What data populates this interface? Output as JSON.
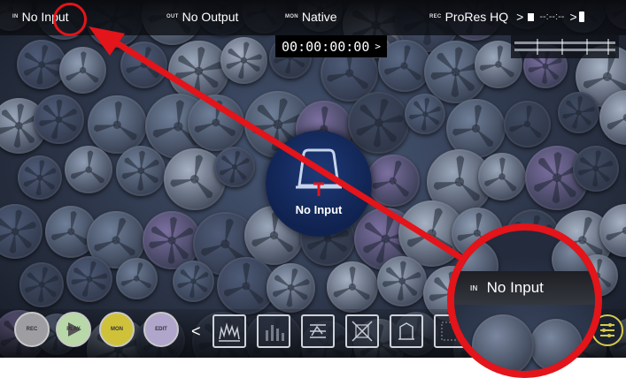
{
  "topbar": {
    "input": {
      "tag": "IN",
      "label": "No Input"
    },
    "output": {
      "tag": "OUT",
      "label": "No Output"
    },
    "monitor": {
      "tag": "MON",
      "label": "Native"
    },
    "record": {
      "tag": "REC",
      "label": "ProRes HQ",
      "arrow": ">",
      "time": "--:--:--",
      "arrow2": ">"
    }
  },
  "timecode": {
    "value": "00:00:00:00",
    "arrow": ">"
  },
  "center": {
    "label": "No Input"
  },
  "zoom": {
    "tag": "IN",
    "label": "No Input"
  },
  "bottom": {
    "buttons": [
      {
        "tag": "REC",
        "color": "#9e9ea2"
      },
      {
        "tag": "PLAY",
        "color": "#b8d8a8"
      },
      {
        "tag": "MON",
        "color": "#cfc23a"
      },
      {
        "tag": "EDIT",
        "color": "#b0a6cc"
      }
    ],
    "chevron": "<"
  },
  "colors": {
    "accent_red": "#e3141a",
    "screen_bg": "#2c3548",
    "menu_ring": "#d7ca4a"
  }
}
